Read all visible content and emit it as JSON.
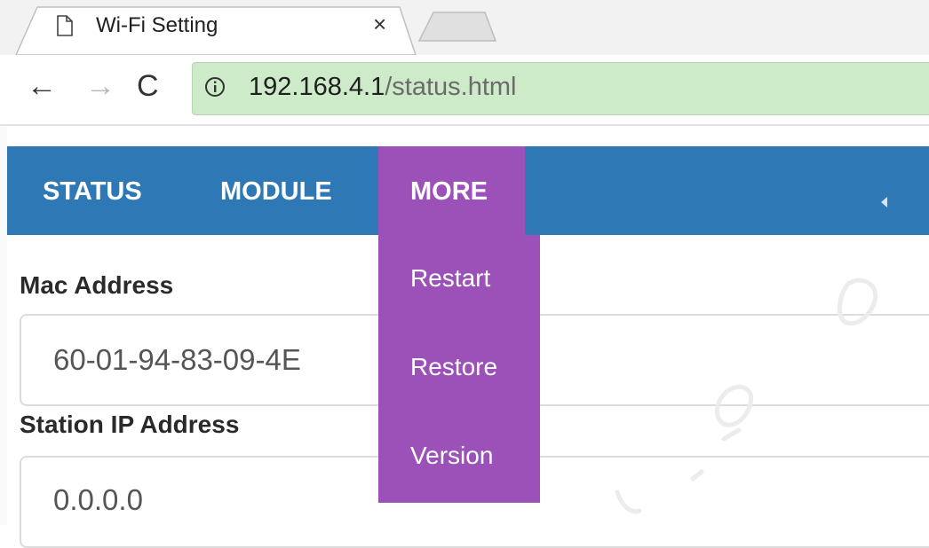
{
  "browser": {
    "tab_title": "Wi-Fi Setting",
    "tab_close": "×",
    "nav_back": "←",
    "nav_forward": "→",
    "nav_reload": "C",
    "url_host": "192.168.4.1",
    "url_path": "/status.html"
  },
  "navbar": {
    "items": [
      {
        "label": "STATUS"
      },
      {
        "label": "MODULE"
      },
      {
        "label": "MORE"
      }
    ],
    "active": "MORE"
  },
  "dropdown": {
    "items": [
      {
        "label": "Restart"
      },
      {
        "label": "Restore"
      },
      {
        "label": "Version"
      }
    ]
  },
  "form": {
    "mac_label": "Mac Address",
    "mac_value": "60-01-94-83-09-4E",
    "ip_label": "Station IP Address",
    "ip_value": "0.0.0.0"
  },
  "colors": {
    "navbar": "#2e78b6",
    "menu_active": "#9b51b8",
    "omnibox": "#cdebc8"
  }
}
